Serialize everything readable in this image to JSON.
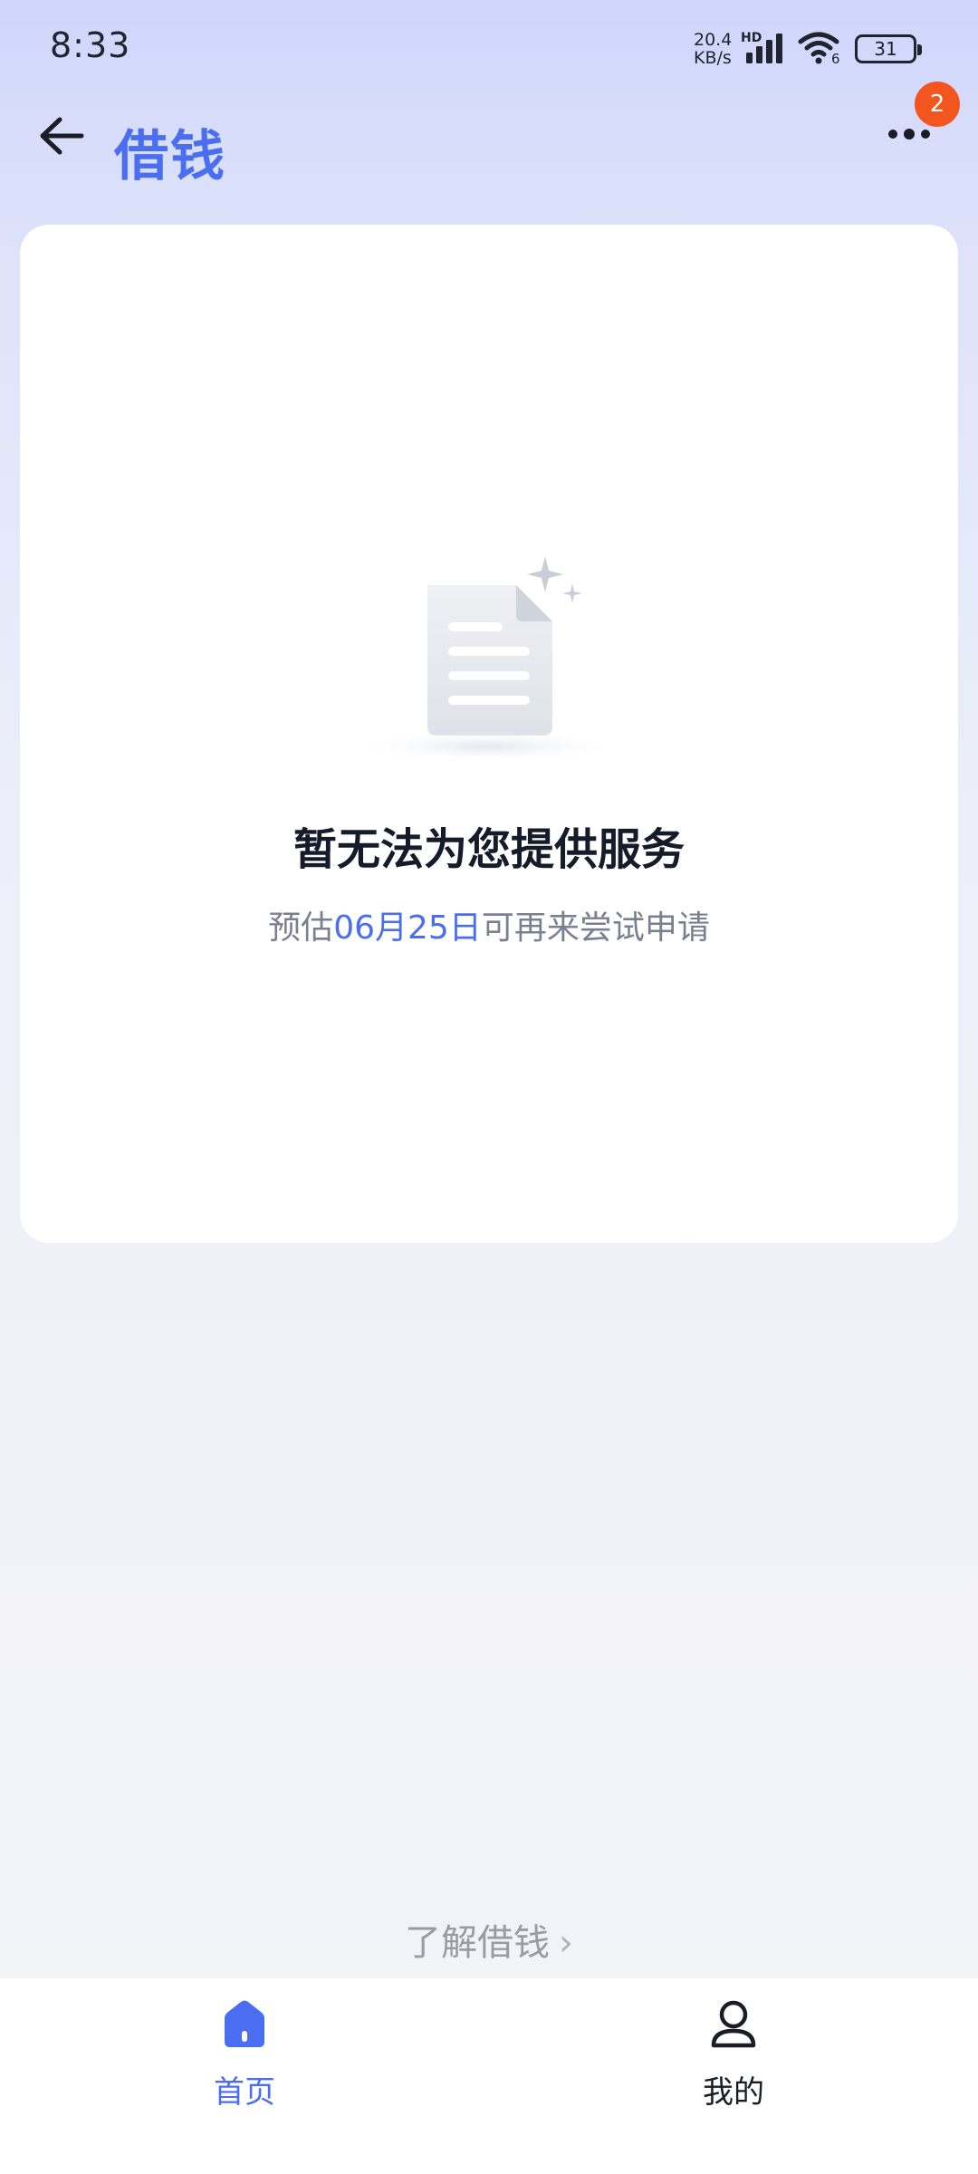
{
  "status_bar": {
    "time": "8:33",
    "net_speed_value": "20.4",
    "net_speed_unit": "KB/s",
    "net_type": "HD",
    "wifi_label": "6",
    "battery": "31"
  },
  "header": {
    "title": "借钱",
    "notification_count": "2"
  },
  "card": {
    "message": "暂无法为您提供服务",
    "sub_prefix": "预估",
    "sub_date": "06月25日",
    "sub_suffix": "可再来尝试申请"
  },
  "learn_more": {
    "label": "了解借钱",
    "chevron": "›"
  },
  "tabbar": {
    "tabs": [
      {
        "label": "首页",
        "icon": "home-icon",
        "active": true
      },
      {
        "label": "我的",
        "icon": "user-icon",
        "active": false
      }
    ]
  },
  "colors": {
    "accent": "#4b6ef0",
    "badge": "#f2561e",
    "text_primary": "#161b2a",
    "text_secondary": "#7b8091"
  }
}
